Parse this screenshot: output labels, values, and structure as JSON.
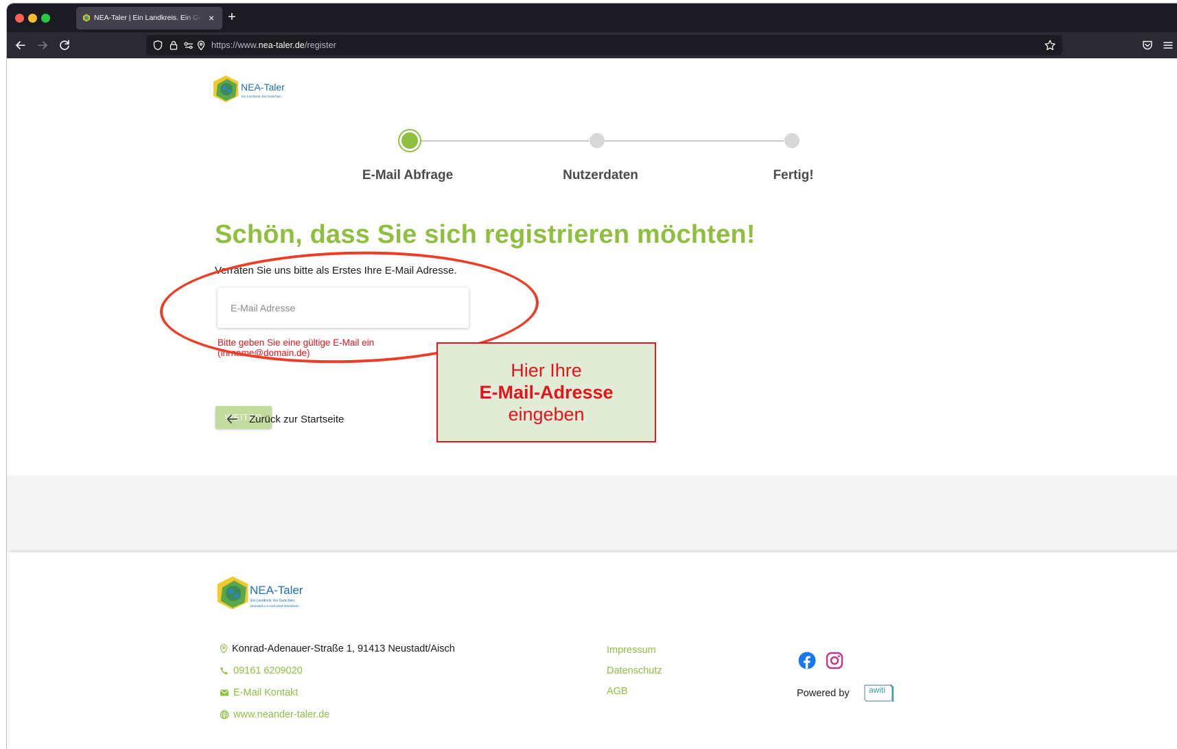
{
  "browser": {
    "tab_title": "NEA-Taler | Ein Landkreis. Ein Gutschein.",
    "tab_close": "×",
    "new_tab": "+",
    "url_prefix": "https://www.",
    "url_host": "nea-taler.de",
    "url_path": "/register"
  },
  "header": {
    "logo_text": "NEA-Taler",
    "logo_sub": "Ein Landkreis. Ein Gutschein."
  },
  "stepper": {
    "steps": [
      {
        "label": "E-Mail Abfrage",
        "active": true
      },
      {
        "label": "Nutzerdaten",
        "active": false
      },
      {
        "label": "Fertig!",
        "active": false
      }
    ]
  },
  "form": {
    "headline": "Schön, dass Sie sich registrieren möchten!",
    "intro": "Verraten Sie uns bitte als Erstes Ihre E-Mail Adresse.",
    "email_placeholder": "E-Mail Adresse",
    "error": "Bitte geben Sie eine gültige E-Mail ein (ihrname@domain.de)",
    "submit_label": "WEITER",
    "back_label": "Zurück zur Startseite"
  },
  "annotation": {
    "line1": "Hier Ihre",
    "line2": "E-Mail-Adresse",
    "line3": "eingeben",
    "color": "#e3141b"
  },
  "footer": {
    "logo_text": "NEA-Taler",
    "logo_sub1": "Ein Landkreis. Ein Gutschein.",
    "logo_sub2": "Neustadt a.d.Aisch-Bad Windsheim",
    "address": "Konrad-Adenauer-Straße 1, 91413 Neustadt/Aisch",
    "phone": "09161 6209020",
    "email_link": "E-Mail Kontakt",
    "website": "www.neander-taler.de",
    "legal": [
      "Impressum",
      "Datenschutz",
      "AGB"
    ],
    "powered_by": "Powered by",
    "powered_brand": "awiti"
  },
  "colors": {
    "brand_green": "#8fbf3f",
    "brand_blue": "#1d6fb8",
    "error_red": "#e3141b"
  }
}
